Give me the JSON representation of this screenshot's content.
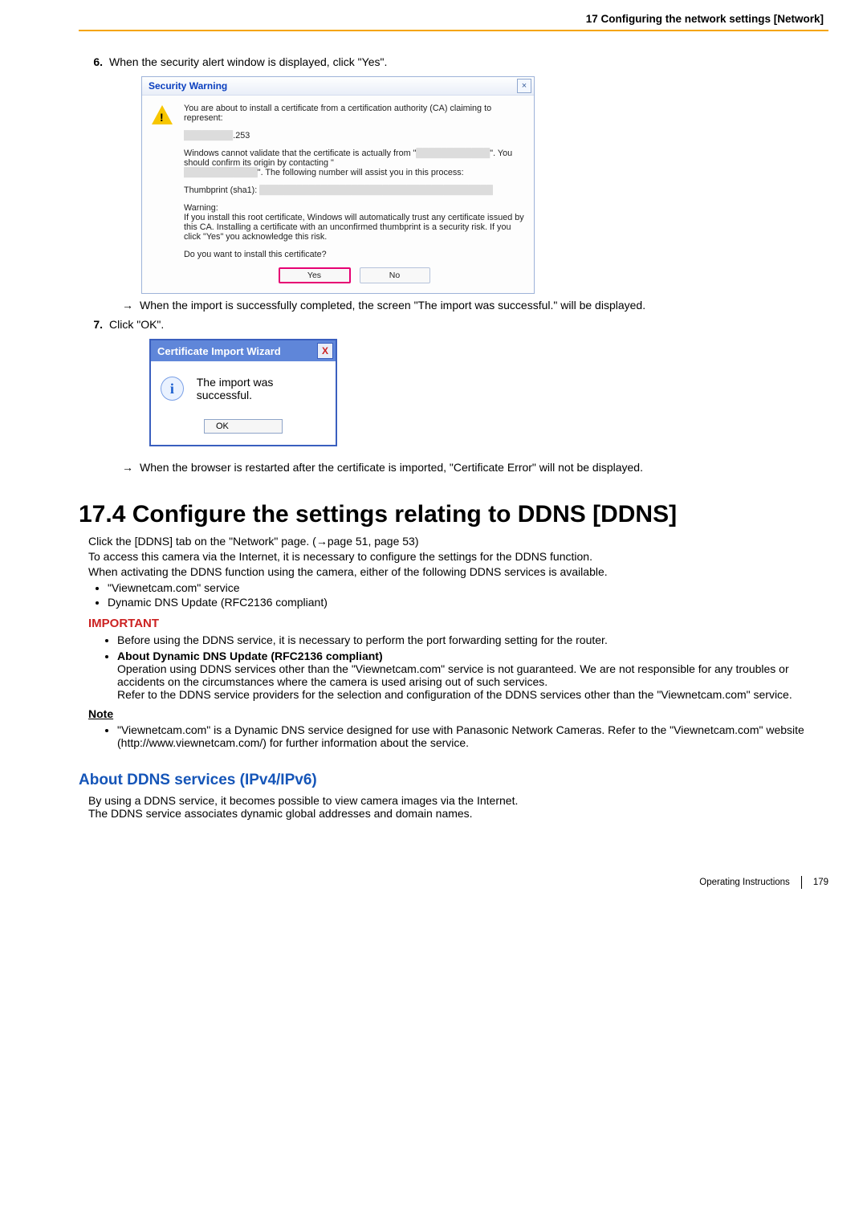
{
  "header": {
    "breadcrumb": "17 Configuring the network settings [Network]"
  },
  "step6": {
    "num": "6.",
    "text": "When the security alert window is displayed, click \"Yes\"."
  },
  "secDlg": {
    "title": "Security Warning",
    "l1": "You are about to install a certificate from a certification authority (CA) claiming to represent:",
    "l2_suffix": ".253",
    "l3a": "Windows cannot validate that the certificate is actually from \"",
    "l3b": "\". You should confirm its origin by contacting \"",
    "l3c": "\". The following number will assist you in this process:",
    "l4": "Thumbprint (sha1): ",
    "l5": "Warning:",
    "l6": "If you install this root certificate, Windows will automatically trust any certificate issued by this CA. Installing a certificate with an unconfirmed thumbprint is a security risk. If you click \"Yes\" you acknowledge this risk.",
    "l7": "Do you want to install this certificate?",
    "yes": "Yes",
    "no": "No"
  },
  "arrow1": "When the import is successfully completed, the screen \"The import was successful.\" will be displayed.",
  "step7": {
    "num": "7.",
    "text": "Click \"OK\"."
  },
  "okDlg": {
    "title": "Certificate Import Wizard",
    "msg": "The import was successful.",
    "ok": "OK"
  },
  "arrow2": "When the browser is restarted after the certificate is imported, \"Certificate Error\" will not be displayed.",
  "section": {
    "title": "17.4  Configure the settings relating to DDNS [DDNS]",
    "p1": "Click the [DDNS] tab on the \"Network\" page. (→page 51, page 53)",
    "p2": "To access this camera via the Internet, it is necessary to configure the settings for the DDNS function.",
    "p3": "When activating the DDNS function using the camera, either of the following DDNS services is available.",
    "b1": "\"Viewnetcam.com\" service",
    "b2": "Dynamic DNS Update (RFC2136 compliant)"
  },
  "important": {
    "title": "IMPORTANT",
    "i1": "Before using the DDNS service, it is necessary to perform the port forwarding setting for the router.",
    "i2t": "About Dynamic DNS Update (RFC2136 compliant)",
    "i2a": "Operation using DDNS services other than the \"Viewnetcam.com\" service is not guaranteed. We are not responsible for any troubles or accidents on the circumstances where the camera is used arising out of such services.",
    "i2b": "Refer to the DDNS service providers for the selection and configuration of the DDNS services other than the \"Viewnetcam.com\" service."
  },
  "note": {
    "title": "Note",
    "n1": "\"Viewnetcam.com\" is a Dynamic DNS service designed for use with Panasonic Network Cameras. Refer to the \"Viewnetcam.com\" website (http://www.viewnetcam.com/) for further information about the service."
  },
  "about": {
    "title": "About DDNS services (IPv4/IPv6)",
    "p1": "By using a DDNS service, it becomes possible to view camera images via the Internet.",
    "p2": "The DDNS service associates dynamic global addresses and domain names."
  },
  "footer": {
    "label": "Operating Instructions",
    "page": "179"
  }
}
